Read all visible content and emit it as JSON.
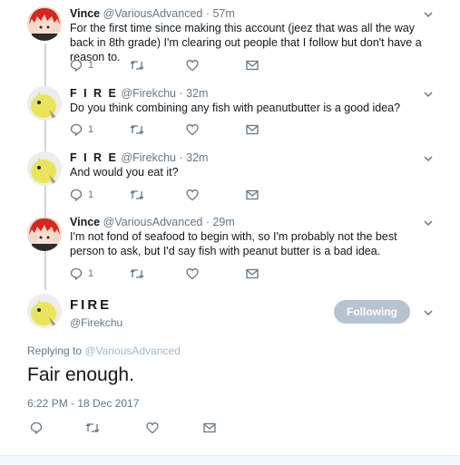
{
  "tweets": [
    {
      "name": "Vince",
      "handle": "@VariousAdvanced",
      "time": "· 57m",
      "text": "For the first time since making this account (jeez that was all the way back in 8th grade) I'm clearing out people that I follow but don't have a reason to.",
      "reply_count": "1"
    },
    {
      "name": "F I R E",
      "handle": "@Firekchu",
      "time": "· 32m",
      "text": "Do you think combining any fish with peanutbutter is a good idea?",
      "reply_count": "1"
    },
    {
      "name": "F I R E",
      "handle": "@Firekchu",
      "time": "· 32m",
      "text": "And would you eat it?",
      "reply_count": "1"
    },
    {
      "name": "Vince",
      "handle": "@VariousAdvanced",
      "time": "· 29m",
      "text": "I'm not fond of seafood to begin with, so I'm probably not the best person to ask, but I'd say fish with peanut butter is a bad idea.",
      "reply_count": "1"
    }
  ],
  "main": {
    "name": "FIRE",
    "handle": "@Firekchu",
    "follow_label": "Following",
    "replying_prefix": "Replying to",
    "replying_to": "@VariousAdvanced",
    "text": "Fair enough.",
    "datetime": "6:22 PM - 18 Dec 2017"
  },
  "colors": {
    "vince_hair": "#d8261f",
    "fire_avatar": "#e8e55a",
    "icon_gray": "#657786",
    "follow_bg": "#b6c4d1"
  },
  "icons": [
    "reply-icon",
    "retweet-icon",
    "like-icon",
    "message-icon",
    "chevron-down-icon"
  ]
}
